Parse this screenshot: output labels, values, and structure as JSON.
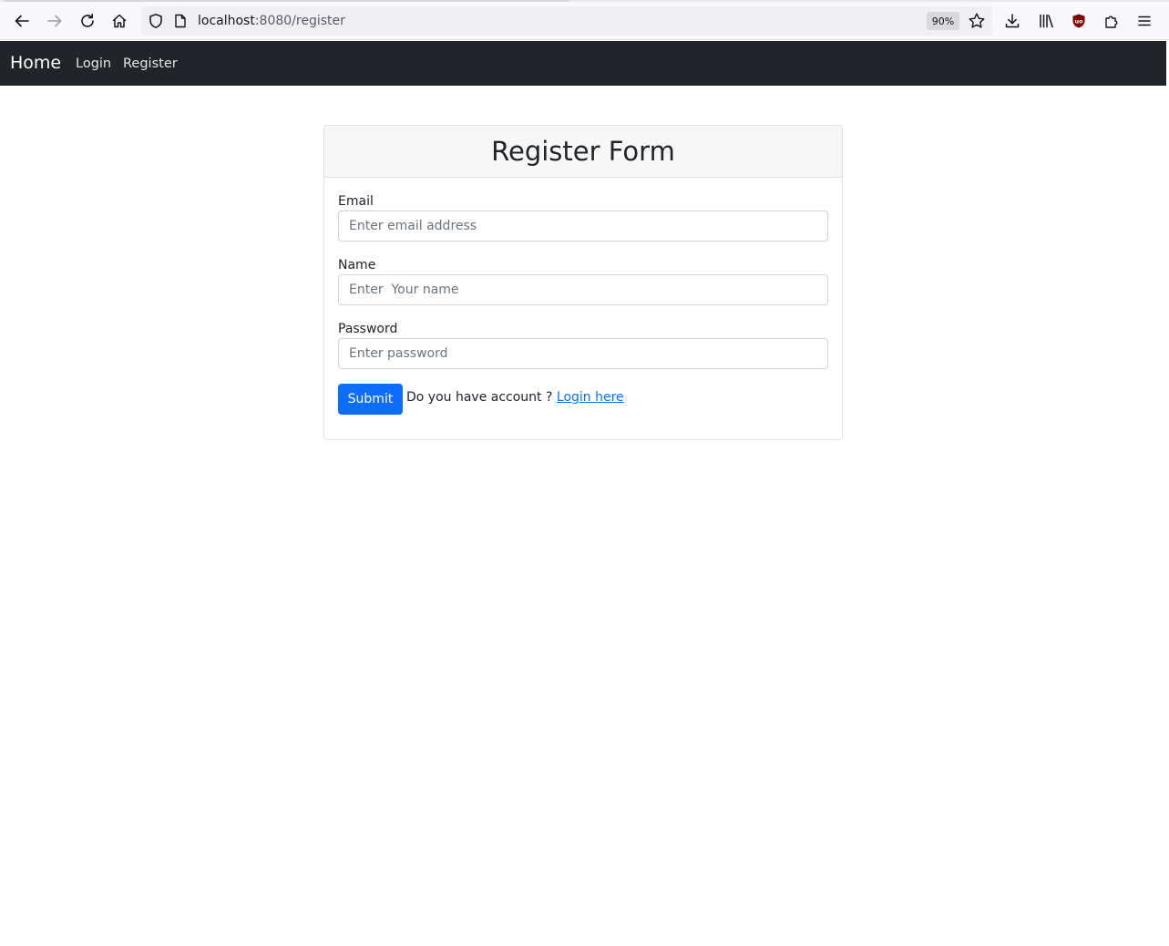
{
  "browser": {
    "url_host": "localhost",
    "url_rest": ":8080/register",
    "zoom": "90%"
  },
  "navbar": {
    "brand": "Home",
    "links": [
      {
        "label": "Login"
      },
      {
        "label": "Register"
      }
    ]
  },
  "form": {
    "title": "Register Form",
    "email": {
      "label": "Email",
      "placeholder": "Enter email address",
      "value": ""
    },
    "name": {
      "label": "Name",
      "placeholder": "Enter  Your name",
      "value": ""
    },
    "password": {
      "label": "Password",
      "placeholder": "Enter password",
      "value": ""
    },
    "submit_label": "Submit",
    "account_prompt": "Do you have account ?",
    "login_link": "Login here"
  },
  "colors": {
    "navbar_bg": "#212529",
    "primary": "#0d6efd",
    "card_header_bg": "#f7f7f7"
  }
}
